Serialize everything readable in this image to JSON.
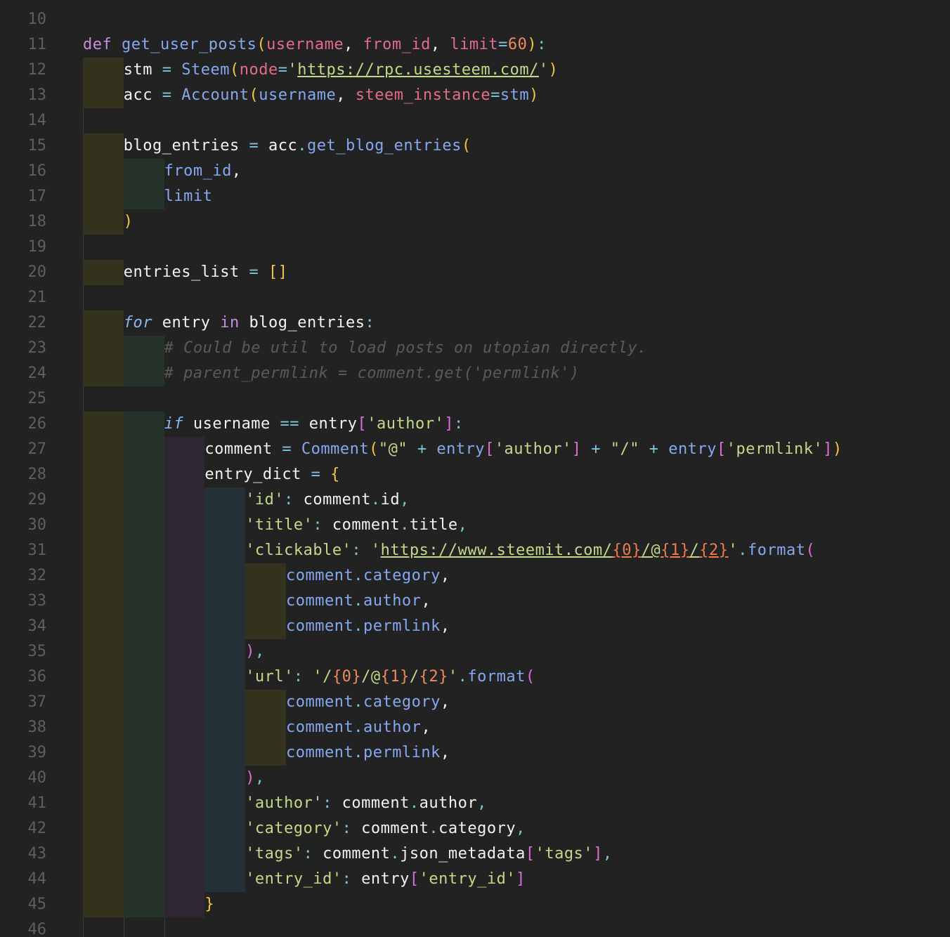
{
  "editor": {
    "line_numbers": [
      "10",
      "11",
      "12",
      "13",
      "14",
      "15",
      "16",
      "17",
      "18",
      "19",
      "20",
      "21",
      "22",
      "23",
      "24",
      "25",
      "26",
      "27",
      "28",
      "29",
      "30",
      "31",
      "32",
      "33",
      "34",
      "35",
      "36",
      "37",
      "38",
      "39",
      "40",
      "41",
      "42",
      "43",
      "44",
      "45",
      "46"
    ],
    "lines": [
      {
        "indent": 0,
        "tokens": []
      },
      {
        "indent": 0,
        "tokens": [
          [
            "k",
            "def "
          ],
          [
            "fn",
            "get_user_posts"
          ],
          [
            "b1",
            "("
          ],
          [
            "p",
            "username"
          ],
          [
            "pl",
            ", "
          ],
          [
            "p",
            "from_id"
          ],
          [
            "pl",
            ", "
          ],
          [
            "p",
            "limit"
          ],
          [
            "op",
            "="
          ],
          [
            "num",
            "60"
          ],
          [
            "b1",
            ")"
          ],
          [
            "op",
            ":"
          ]
        ]
      },
      {
        "indent": 1,
        "tokens": [
          [
            "pl",
            "stm "
          ],
          [
            "op",
            "="
          ],
          [
            "pl",
            " "
          ],
          [
            "fn",
            "Steem"
          ],
          [
            "b1",
            "("
          ],
          [
            "p",
            "node"
          ],
          [
            "op",
            "="
          ],
          [
            "s",
            "'"
          ],
          [
            "u",
            "https://rpc.usesteem.com/"
          ],
          [
            "s",
            "'"
          ],
          [
            "b1",
            ")"
          ]
        ]
      },
      {
        "indent": 1,
        "tokens": [
          [
            "pl",
            "acc "
          ],
          [
            "op",
            "="
          ],
          [
            "pl",
            " "
          ],
          [
            "fn",
            "Account"
          ],
          [
            "b1",
            "("
          ],
          [
            "att",
            "username"
          ],
          [
            "pl",
            ", "
          ],
          [
            "p",
            "steem_instance"
          ],
          [
            "op",
            "="
          ],
          [
            "att",
            "stm"
          ],
          [
            "b1",
            ")"
          ]
        ]
      },
      {
        "indent": 0,
        "tokens": []
      },
      {
        "indent": 1,
        "tokens": [
          [
            "pl",
            "blog_entries "
          ],
          [
            "op",
            "="
          ],
          [
            "pl",
            " acc"
          ],
          [
            "op",
            "."
          ],
          [
            "fn",
            "get_blog_entries"
          ],
          [
            "b1",
            "("
          ]
        ]
      },
      {
        "indent": 2,
        "tokens": [
          [
            "att",
            "from_id"
          ],
          [
            "pl",
            ","
          ]
        ]
      },
      {
        "indent": 2,
        "tokens": [
          [
            "att",
            "limit"
          ]
        ]
      },
      {
        "indent": 1,
        "tokens": [
          [
            "b1",
            ")"
          ]
        ]
      },
      {
        "indent": 0,
        "tokens": []
      },
      {
        "indent": 1,
        "tokens": [
          [
            "pl",
            "entries_list "
          ],
          [
            "op",
            "="
          ],
          [
            "pl",
            " "
          ],
          [
            "b1",
            "[]"
          ]
        ]
      },
      {
        "indent": 0,
        "tokens": []
      },
      {
        "indent": 1,
        "tokens": [
          [
            "kw",
            "for"
          ],
          [
            "pl",
            " entry "
          ],
          [
            "k",
            "in"
          ],
          [
            "pl",
            " blog_entries"
          ],
          [
            "op",
            ":"
          ]
        ]
      },
      {
        "indent": 2,
        "tokens": [
          [
            "c",
            "# Could be util to load posts on utopian directly."
          ]
        ]
      },
      {
        "indent": 2,
        "tokens": [
          [
            "c",
            "# parent_permlink = comment.get('permlink')"
          ]
        ]
      },
      {
        "indent": 0,
        "tokens": []
      },
      {
        "indent": 2,
        "tokens": [
          [
            "kw",
            "if"
          ],
          [
            "pl",
            " username "
          ],
          [
            "op",
            "=="
          ],
          [
            "pl",
            " entry"
          ],
          [
            "b2",
            "["
          ],
          [
            "s",
            "'author'"
          ],
          [
            "b2",
            "]"
          ],
          [
            "op",
            ":"
          ]
        ]
      },
      {
        "indent": 3,
        "tokens": [
          [
            "pl",
            "comment "
          ],
          [
            "op",
            "="
          ],
          [
            "pl",
            " "
          ],
          [
            "fn",
            "Comment"
          ],
          [
            "b1",
            "("
          ],
          [
            "s",
            "\"@\""
          ],
          [
            "pl",
            " "
          ],
          [
            "op",
            "+"
          ],
          [
            "pl",
            " "
          ],
          [
            "att",
            "entry"
          ],
          [
            "b2",
            "["
          ],
          [
            "s",
            "'author'"
          ],
          [
            "b2",
            "]"
          ],
          [
            "pl",
            " "
          ],
          [
            "op",
            "+"
          ],
          [
            "pl",
            " "
          ],
          [
            "s",
            "\"/\""
          ],
          [
            "pl",
            " "
          ],
          [
            "op",
            "+"
          ],
          [
            "pl",
            " "
          ],
          [
            "att",
            "entry"
          ],
          [
            "b2",
            "["
          ],
          [
            "s",
            "'permlink'"
          ],
          [
            "b2",
            "]"
          ],
          [
            "b1",
            ")"
          ]
        ]
      },
      {
        "indent": 3,
        "tokens": [
          [
            "pl",
            "entry_dict "
          ],
          [
            "op",
            "="
          ],
          [
            "pl",
            " "
          ],
          [
            "b1",
            "{"
          ]
        ]
      },
      {
        "indent": 4,
        "tokens": [
          [
            "s",
            "'id'"
          ],
          [
            "op",
            ":"
          ],
          [
            "pl",
            " comment"
          ],
          [
            "op",
            "."
          ],
          [
            "pl",
            "id"
          ],
          [
            "op",
            ","
          ]
        ]
      },
      {
        "indent": 4,
        "tokens": [
          [
            "s",
            "'title'"
          ],
          [
            "op",
            ":"
          ],
          [
            "pl",
            " comment"
          ],
          [
            "op",
            "."
          ],
          [
            "pl",
            "title"
          ],
          [
            "op",
            ","
          ]
        ]
      },
      {
        "indent": 4,
        "tokens": [
          [
            "s",
            "'clickable'"
          ],
          [
            "op",
            ":"
          ],
          [
            "pl",
            " "
          ],
          [
            "s",
            "'"
          ],
          [
            "u",
            "https://www.steemit.com/"
          ],
          [
            "fmt",
            "{0}"
          ],
          [
            "u",
            "/@"
          ],
          [
            "fmt",
            "{1}"
          ],
          [
            "u",
            "/"
          ],
          [
            "fmt",
            "{2}"
          ],
          [
            "s",
            "'"
          ],
          [
            "op",
            "."
          ],
          [
            "fn",
            "format"
          ],
          [
            "b2",
            "("
          ]
        ]
      },
      {
        "indent": 5,
        "tokens": [
          [
            "att",
            "comment"
          ],
          [
            "op",
            "."
          ],
          [
            "att",
            "category"
          ],
          [
            "pl",
            ","
          ]
        ]
      },
      {
        "indent": 5,
        "tokens": [
          [
            "att",
            "comment"
          ],
          [
            "op",
            "."
          ],
          [
            "att",
            "author"
          ],
          [
            "pl",
            ","
          ]
        ]
      },
      {
        "indent": 5,
        "tokens": [
          [
            "att",
            "comment"
          ],
          [
            "op",
            "."
          ],
          [
            "att",
            "permlink"
          ],
          [
            "pl",
            ","
          ]
        ]
      },
      {
        "indent": 4,
        "tokens": [
          [
            "b2",
            ")"
          ],
          [
            "op",
            ","
          ]
        ]
      },
      {
        "indent": 4,
        "tokens": [
          [
            "s",
            "'url'"
          ],
          [
            "op",
            ":"
          ],
          [
            "pl",
            " "
          ],
          [
            "s",
            "'/"
          ],
          [
            "num",
            "{0}"
          ],
          [
            "s",
            "/@"
          ],
          [
            "num",
            "{1}"
          ],
          [
            "s",
            "/"
          ],
          [
            "num",
            "{2}"
          ],
          [
            "s",
            "'"
          ],
          [
            "op",
            "."
          ],
          [
            "fn",
            "format"
          ],
          [
            "b2",
            "("
          ]
        ]
      },
      {
        "indent": 5,
        "tokens": [
          [
            "att",
            "comment"
          ],
          [
            "op",
            "."
          ],
          [
            "att",
            "category"
          ],
          [
            "pl",
            ","
          ]
        ]
      },
      {
        "indent": 5,
        "tokens": [
          [
            "att",
            "comment"
          ],
          [
            "op",
            "."
          ],
          [
            "att",
            "author"
          ],
          [
            "pl",
            ","
          ]
        ]
      },
      {
        "indent": 5,
        "tokens": [
          [
            "att",
            "comment"
          ],
          [
            "op",
            "."
          ],
          [
            "att",
            "permlink"
          ],
          [
            "pl",
            ","
          ]
        ]
      },
      {
        "indent": 4,
        "tokens": [
          [
            "b2",
            ")"
          ],
          [
            "op",
            ","
          ]
        ]
      },
      {
        "indent": 4,
        "tokens": [
          [
            "s",
            "'author'"
          ],
          [
            "op",
            ":"
          ],
          [
            "pl",
            " comment"
          ],
          [
            "op",
            "."
          ],
          [
            "pl",
            "author"
          ],
          [
            "op",
            ","
          ]
        ]
      },
      {
        "indent": 4,
        "tokens": [
          [
            "s",
            "'category'"
          ],
          [
            "op",
            ":"
          ],
          [
            "pl",
            " comment"
          ],
          [
            "op",
            "."
          ],
          [
            "pl",
            "category"
          ],
          [
            "op",
            ","
          ]
        ]
      },
      {
        "indent": 4,
        "tokens": [
          [
            "s",
            "'tags'"
          ],
          [
            "op",
            ":"
          ],
          [
            "pl",
            " comment"
          ],
          [
            "op",
            "."
          ],
          [
            "pl",
            "json_metadata"
          ],
          [
            "b2",
            "["
          ],
          [
            "s",
            "'tags'"
          ],
          [
            "b2",
            "]"
          ],
          [
            "op",
            ","
          ]
        ]
      },
      {
        "indent": 4,
        "tokens": [
          [
            "s",
            "'entry_id'"
          ],
          [
            "op",
            ":"
          ],
          [
            "pl",
            " entry"
          ],
          [
            "b2",
            "["
          ],
          [
            "s",
            "'entry_id'"
          ],
          [
            "b2",
            "]"
          ]
        ]
      },
      {
        "indent": 3,
        "tokens": [
          [
            "b1",
            "}"
          ]
        ]
      },
      {
        "indent": 0,
        "tokens": []
      }
    ]
  },
  "colors": {
    "background": "#222222",
    "line_number": "#5f5f5f",
    "indent_level_1": "#32321f",
    "indent_level_2": "#26332a",
    "indent_level_3": "#2f2633",
    "indent_level_4": "#233136"
  }
}
